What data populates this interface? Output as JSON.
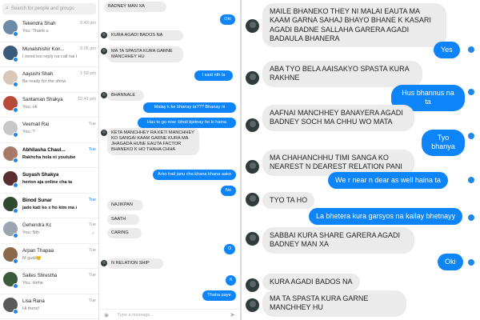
{
  "search": {
    "placeholder": "Search for people and groups"
  },
  "contacts": [
    {
      "name": "Tekendra Shah",
      "preview": "You: Thank u",
      "time": "5:43 pm",
      "read": "",
      "bold": false,
      "avatar": "#6d8aa6"
    },
    {
      "name": "Munalshishir Koir...",
      "preview": "I need too reply na call nai k...",
      "time": "5:05 pm",
      "read": "",
      "bold": false,
      "avatar": "#3a5a7a"
    },
    {
      "name": "Aayushi Shah",
      "preview": "Be ready for the show",
      "time": "1:59 pm",
      "read": "",
      "bold": false,
      "avatar": "#d9c7b8"
    },
    {
      "name": "Santaman Shakya",
      "preview": "You: ok",
      "time": "12:41 pm",
      "read": "",
      "bold": false,
      "avatar": "#b84a3a"
    },
    {
      "name": "Veemall Rai",
      "preview": "You: ?",
      "time": "Tue",
      "read": "",
      "bold": false,
      "avatar": "#c7c7c7"
    },
    {
      "name": "Abhilasha Chaul...",
      "preview": "Rakhcha hola ni youtube ma",
      "time": "Tue",
      "read": "",
      "bold": true,
      "avatar": "#a87a6a"
    },
    {
      "name": "Suyash Shakya",
      "preview": "herion aja online cha ta",
      "time": "",
      "read": "",
      "bold": true,
      "avatar": "#5a2e2e"
    },
    {
      "name": "Binod Sunar",
      "preview": "jado kati ko x ho ktm ma Aay...",
      "time": "Tue",
      "read": "",
      "bold": true,
      "avatar": "#2e4a2e"
    },
    {
      "name": "Gehendra Kc",
      "preview": "You: Nth",
      "time": "Tue",
      "read": "✓",
      "bold": false,
      "avatar": "#9aa5b0"
    },
    {
      "name": "Arpan Thapaa",
      "preview": "M gudi😊",
      "time": "Tue",
      "read": "",
      "bold": false,
      "avatar": "#8a6a4a"
    },
    {
      "name": "Sailes Shrestha",
      "preview": "You: Hehe",
      "time": "Tue",
      "read": "",
      "bold": false,
      "avatar": "#3a5a3a"
    },
    {
      "name": "Lisa Rana",
      "preview": "Hi there!",
      "time": "Tue",
      "read": "",
      "bold": false,
      "avatar": "#5a5a5a"
    }
  ],
  "chat_mid": {
    "input_placeholder": "Type a message...",
    "messages": [
      {
        "dir": "in",
        "text": "BADNEY MAN XA"
      },
      {
        "dir": "out",
        "text": "Oki"
      },
      {
        "dir": "in",
        "text": "KURA AGADI BADOS NA"
      },
      {
        "dir": "in",
        "text": "MA TA SPASTA KURA GARNE MANCHHEY HU"
      },
      {
        "dir": "out",
        "text": "I said nth ta"
      },
      {
        "dir": "in",
        "text": "BHANNALE"
      },
      {
        "dir": "out",
        "text": "Malay k ke bhanay ta??? Bhanay ni"
      },
      {
        "dir": "out",
        "text": "Hav to go now :bholi bjetnay ho ki haina"
      },
      {
        "dir": "in",
        "text": "KETA MANCHHEY RA KETI MANCHHEY KO SANGAI KAAM GARNE KURA MA JHAGADA HUNE EAUTA FACTOR BHANEKO K HO THAHA CHHA"
      },
      {
        "dir": "out",
        "text": "Arko trail janu cha khana khana aako"
      },
      {
        "dir": "out",
        "text": "No"
      },
      {
        "dir": "in",
        "text": "NAJIKPAN"
      },
      {
        "dir": "in",
        "text": "SAATH"
      },
      {
        "dir": "in",
        "text": "CARING"
      },
      {
        "dir": "out",
        "text": "O"
      },
      {
        "dir": "in",
        "text": "N RELATION SHIP"
      },
      {
        "dir": "out",
        "text": "K"
      },
      {
        "dir": "out",
        "text": "Thaha paye"
      }
    ]
  },
  "chat_right": {
    "messages": [
      {
        "dir": "in",
        "text": "MAILE BHANEKO THEY NI MALAI EAUTA MA KAAM GARNA SAHAJ BHAYO BHANE K KASARI AGADI BADNE SALLAHA GARERA AGADI BADAULA BHANERA"
      },
      {
        "dir": "out",
        "text": "Yes"
      },
      {
        "dir": "in",
        "text": "ABA TYO BELA AAISAKYO SPASTA KURA RAKHNE"
      },
      {
        "dir": "out",
        "text": "Hus bhannus na ta"
      },
      {
        "dir": "in",
        "text": "AAFNAI MANCHHEY BANAYERA AGADI BADNEY SOCH MA CHHU WO MATA"
      },
      {
        "dir": "out",
        "text": "Tyo bhanya"
      },
      {
        "dir": "in",
        "text": "MA CHAHANCHHU TIMI SANGA KO NEAREST N DEAREST RELATION PANI"
      },
      {
        "dir": "out",
        "text": "We r near n dear as well haina ta"
      },
      {
        "dir": "in",
        "text": "TYO TA HO"
      },
      {
        "dir": "out",
        "text": "La bhetera kura garsyos na kailay bhetnayy"
      },
      {
        "dir": "in",
        "text": "SABBAI KURA SHARE GARERA AGADI BADNEY MAN XA"
      },
      {
        "dir": "out",
        "text": "Oki"
      },
      {
        "dir": "in",
        "text": "KURA AGADI BADOS NA"
      },
      {
        "dir": "in",
        "text": "MA TA SPASTA KURA GARNE MANCHHEY HU"
      }
    ]
  },
  "colors": {
    "accent": "#0d84f8",
    "incoming": "#ebebeb"
  },
  "icons": {
    "search": "search-icon",
    "camera": "camera-icon",
    "send": "send-icon"
  }
}
